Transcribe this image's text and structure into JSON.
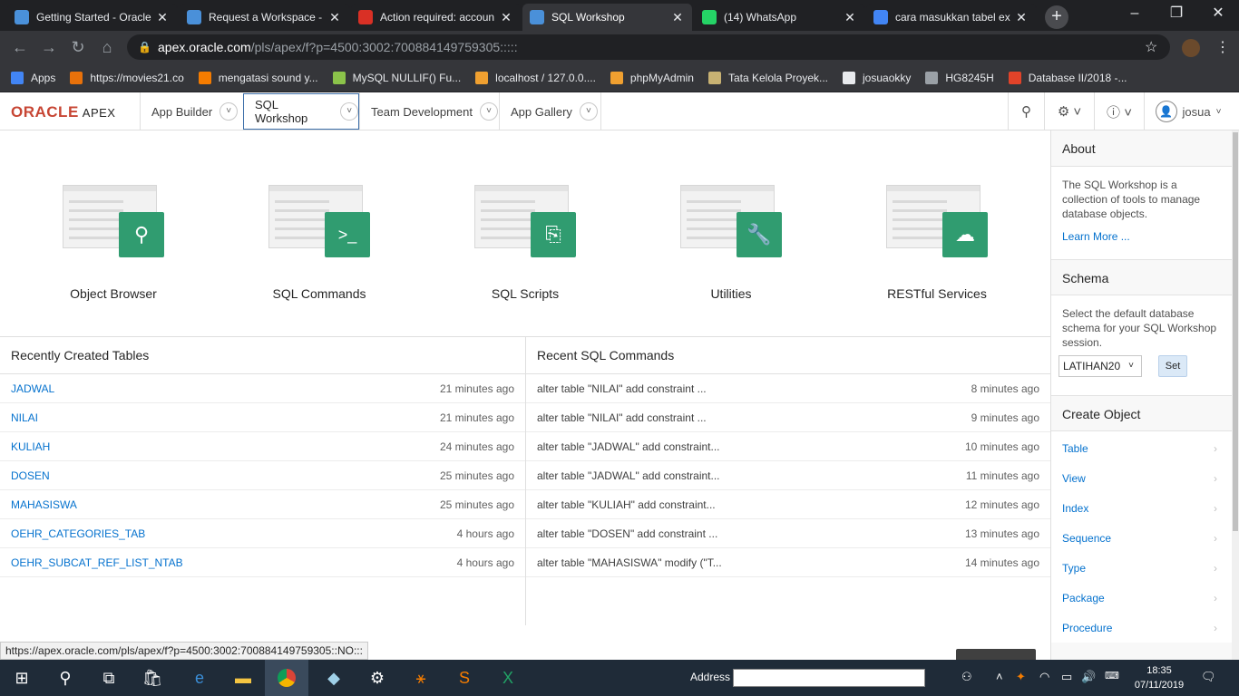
{
  "browser": {
    "tabs": [
      {
        "title": "Getting Started - Oracle",
        "favicon": "apex-icon",
        "color": "#4a90d9",
        "active": false
      },
      {
        "title": "Request a Workspace -",
        "favicon": "apex-icon",
        "color": "#4a90d9",
        "active": false
      },
      {
        "title": "Action required: accoun",
        "favicon": "gmail-icon",
        "color": "#d93025",
        "active": false
      },
      {
        "title": "SQL Workshop",
        "favicon": "apex-icon",
        "color": "#4a90d9",
        "active": true
      },
      {
        "title": "(14) WhatsApp",
        "favicon": "whatsapp-icon",
        "color": "#25d366",
        "active": false
      },
      {
        "title": "cara masukkan tabel ex",
        "favicon": "google-icon",
        "color": "#4285f4",
        "active": false
      }
    ],
    "url_host": "apex.oracle.com",
    "url_path": "/pls/apex/f?p=4500:3002:700884149759305:::::",
    "bookmarks": [
      {
        "label": "Apps",
        "color": "#4285f4"
      },
      {
        "label": "https://movies21.co",
        "color": "#e8710a"
      },
      {
        "label": "mengatasi sound y...",
        "color": "#f57c00"
      },
      {
        "label": "MySQL NULLIF() Fu...",
        "color": "#8bc34a"
      },
      {
        "label": "localhost / 127.0.0....",
        "color": "#f0a030"
      },
      {
        "label": "phpMyAdmin",
        "color": "#f0a030"
      },
      {
        "label": "Tata Kelola Proyek...",
        "color": "#c8b273"
      },
      {
        "label": "josuaokky",
        "color": "#e8eaed"
      },
      {
        "label": "HG8245H",
        "color": "#9aa0a6"
      },
      {
        "label": "Database II/2018 -...",
        "color": "#e24329"
      }
    ],
    "status_url": "https://apex.oracle.com/pls/apex/f?p=4500:3002:700884149759305::NO:::"
  },
  "header": {
    "logo_oracle": "ORACLE",
    "logo_apex": "APEX",
    "nav": [
      {
        "label": "App Builder",
        "active": false
      },
      {
        "label": "SQL Workshop",
        "active": true
      },
      {
        "label": "Team Development",
        "active": false
      },
      {
        "label": "App Gallery",
        "active": false
      }
    ],
    "user": "josua"
  },
  "tiles": [
    {
      "label": "Object Browser",
      "icon": "search-icon",
      "glyph": "⚲"
    },
    {
      "label": "SQL Commands",
      "icon": "terminal-icon",
      "glyph": ">_"
    },
    {
      "label": "SQL Scripts",
      "icon": "script-icon",
      "glyph": "⎘"
    },
    {
      "label": "Utilities",
      "icon": "wrench-icon",
      "glyph": "🔧"
    },
    {
      "label": "RESTful Services",
      "icon": "cloud-upload-icon",
      "glyph": "☁"
    }
  ],
  "recent_tables": {
    "title": "Recently Created Tables",
    "rows": [
      {
        "name": "JADWAL",
        "age": "21 minutes ago"
      },
      {
        "name": "NILAI",
        "age": "21 minutes ago"
      },
      {
        "name": "KULIAH",
        "age": "24 minutes ago"
      },
      {
        "name": "DOSEN",
        "age": "25 minutes ago"
      },
      {
        "name": "MAHASISWA",
        "age": "25 minutes ago"
      },
      {
        "name": "OEHR_CATEGORIES_TAB",
        "age": "4 hours ago"
      },
      {
        "name": "OEHR_SUBCAT_REF_LIST_NTAB",
        "age": "4 hours ago"
      }
    ]
  },
  "recent_sql": {
    "title": "Recent SQL Commands",
    "rows": [
      {
        "cmd": "alter table \"NILAI\" add constraint ...",
        "age": "8 minutes ago"
      },
      {
        "cmd": "alter table \"NILAI\" add constraint ...",
        "age": "9 minutes ago"
      },
      {
        "cmd": "alter table \"JADWAL\" add constraint...",
        "age": "10 minutes ago"
      },
      {
        "cmd": "alter table \"JADWAL\" add constraint...",
        "age": "11 minutes ago"
      },
      {
        "cmd": "alter table \"KULIAH\" add constraint...",
        "age": "12 minutes ago"
      },
      {
        "cmd": "alter table \"DOSEN\" add constraint ...",
        "age": "13 minutes ago"
      },
      {
        "cmd": "alter table \"MAHASISWA\" modify (\"T...",
        "age": "14 minutes ago"
      }
    ]
  },
  "sidebar": {
    "about_title": "About",
    "about_text": "The SQL Workshop is a collection of tools to manage database objects.",
    "learn_more": "Learn More ...",
    "schema_title": "Schema",
    "schema_text": "Select the default database schema for your SQL Workshop session.",
    "schema_value": "LATIHAN20",
    "set_label": "Set",
    "create_title": "Create Object",
    "create_items": [
      "Table",
      "View",
      "Index",
      "Sequence",
      "Type",
      "Package",
      "Procedure"
    ]
  },
  "taskbar": {
    "address_label": "Address",
    "time": "18:35",
    "date": "07/11/2019"
  },
  "colors": {
    "oracle_red": "#c74634",
    "tile_green": "#309c70",
    "link_blue": "#0572ce"
  }
}
